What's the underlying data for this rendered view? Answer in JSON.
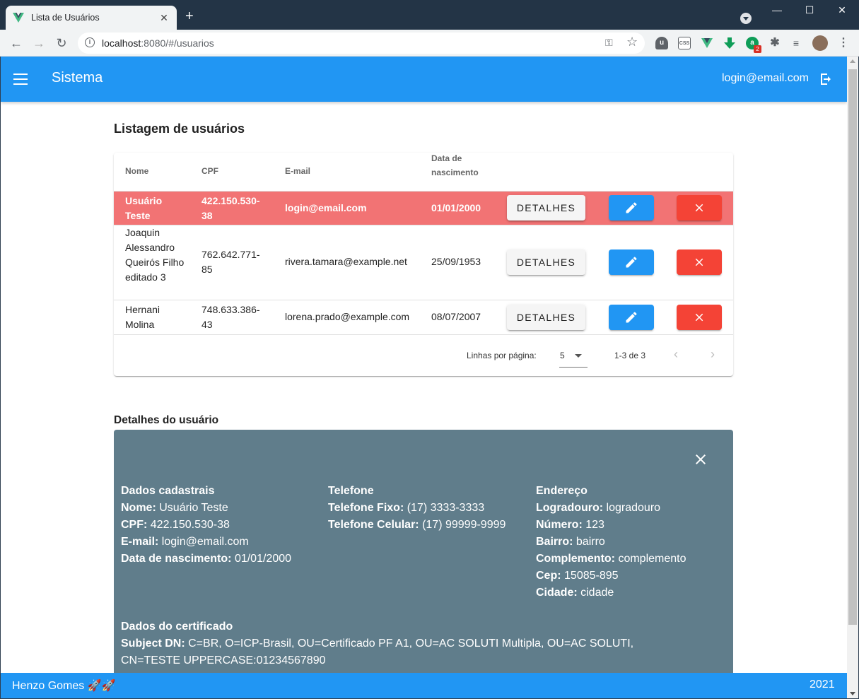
{
  "browser": {
    "tab_title": "Lista de Usuários",
    "url_host": "localhost",
    "url_rest": ":8080/#/usuarios",
    "extension_badge": "2"
  },
  "appbar": {
    "title": "Sistema",
    "user_email": "login@email.com"
  },
  "list": {
    "title": "Listagem de usuários",
    "headers": {
      "nome": "Nome",
      "cpf": "CPF",
      "email": "E-mail",
      "nascimento": "Data de nascimento"
    },
    "rows": [
      {
        "nome": "Usuário Teste",
        "cpf": "422.150.530-38",
        "email": "login@email.com",
        "nascimento": "01/01/2000",
        "details": "DETALHES"
      },
      {
        "nome": "Joaquin Alessandro Queirós Filho editado 3",
        "cpf": "762.642.771-85",
        "email": "rivera.tamara@example.net",
        "nascimento": "25/09/1953",
        "details": "DETALHES"
      },
      {
        "nome": "Hernani Molina",
        "cpf": "748.633.386-43",
        "email": "lorena.prado@example.com",
        "nascimento": "08/07/2007",
        "details": "DETALHES"
      }
    ],
    "footer": {
      "rows_per_page_label": "Linhas por página:",
      "rows_per_page_value": "5",
      "range": "1-3 de 3"
    }
  },
  "details": {
    "title": "Detalhes do usuário",
    "cadastrais": {
      "heading": "Dados cadastrais",
      "nome_label": "Nome:",
      "nome": "Usuário Teste",
      "cpf_label": "CPF:",
      "cpf": "422.150.530-38",
      "email_label": "E-mail:",
      "email": "login@email.com",
      "nasc_label": "Data de nascimento:",
      "nasc": "01/01/2000"
    },
    "telefone": {
      "heading": "Telefone",
      "fixo_label": "Telefone Fixo:",
      "fixo": "(17) 3333-3333",
      "celular_label": "Telefone Celular:",
      "celular": "(17) 99999-9999"
    },
    "endereco": {
      "heading": "Endereço",
      "logradouro_label": "Logradouro:",
      "logradouro": "logradouro",
      "numero_label": "Número:",
      "numero": "123",
      "bairro_label": "Bairro:",
      "bairro": "bairro",
      "complemento_label": "Complemento:",
      "complemento": "complemento",
      "cep_label": "Cep:",
      "cep": "15085-895",
      "cidade_label": "Cidade:",
      "cidade": "cidade"
    },
    "certificado": {
      "heading": "Dados do certificado",
      "subject_label": "Subject DN:",
      "subject": "C=BR, O=ICP-Brasil, OU=Certificado PF A1, OU=AC SOLUTI Multipla, OU=AC SOLUTI, CN=TESTE UPPERCASE:01234567890"
    }
  },
  "footer": {
    "author": "Henzo Gomes 🚀🚀",
    "year": "2021"
  },
  "colors": {
    "primary": "#2196f3",
    "selected_row": "#f27374",
    "details_bg": "#607d8b",
    "delete": "#f44336"
  }
}
